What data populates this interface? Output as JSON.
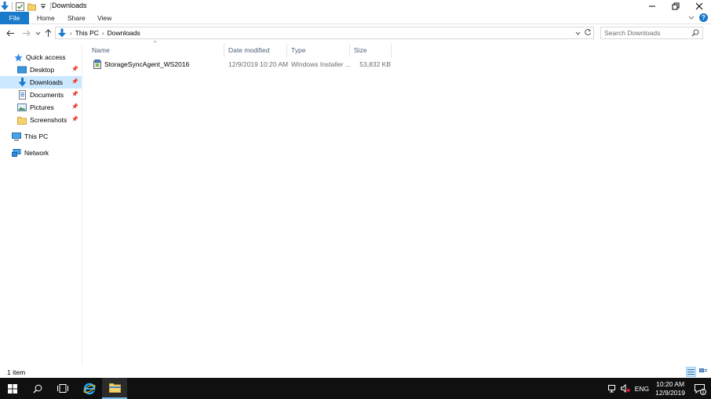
{
  "window": {
    "title": "Downloads"
  },
  "ribbon": {
    "tabs": [
      "File",
      "Home",
      "Share",
      "View"
    ]
  },
  "address": {
    "crumbs": [
      "This PC",
      "Downloads"
    ]
  },
  "search": {
    "placeholder": "Search Downloads"
  },
  "nav": {
    "items": [
      {
        "label": "Quick access",
        "icon": "star-icon"
      },
      {
        "label": "Desktop",
        "icon": "desktop-icon",
        "pinned": true
      },
      {
        "label": "Downloads",
        "icon": "download-icon",
        "pinned": true,
        "selected": true
      },
      {
        "label": "Documents",
        "icon": "documents-icon",
        "pinned": true
      },
      {
        "label": "Pictures",
        "icon": "pictures-icon",
        "pinned": true
      },
      {
        "label": "Screenshots",
        "icon": "folder-icon",
        "pinned": true
      },
      {
        "label": "This PC",
        "icon": "computer-icon"
      },
      {
        "label": "Network",
        "icon": "network-icon"
      }
    ]
  },
  "columns": [
    "Name",
    "Date modified",
    "Type",
    "Size"
  ],
  "files": [
    {
      "name": "StorageSyncAgent_WS2016",
      "date": "12/9/2019 10:20 AM",
      "type": "Windows Installer ...",
      "size": "53,832 KB",
      "icon": "installer-icon"
    }
  ],
  "status": {
    "count": "1 item"
  },
  "taskbar": {
    "lang": "ENG",
    "time": "10:20 AM",
    "date": "12/9/2019",
    "notifications": "1"
  },
  "colors": {
    "accent": "#1979ca",
    "selection": "#cce8ff",
    "taskbar": "#101010"
  }
}
